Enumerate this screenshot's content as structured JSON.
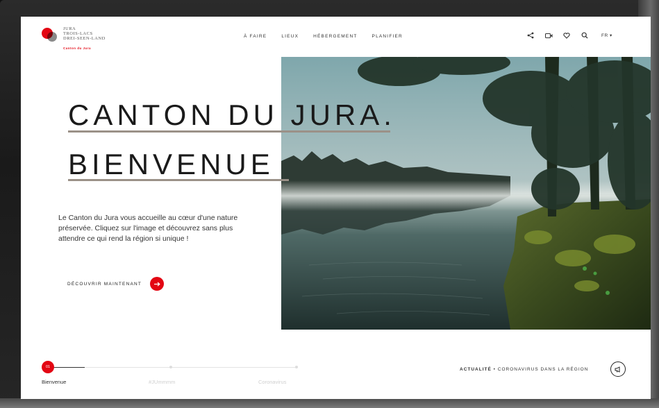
{
  "brand": {
    "lines": [
      "Jura",
      "Trois-Lacs",
      "Drei-Seen-Land"
    ],
    "sub": "Canton du Jura",
    "color_primary": "#e30613"
  },
  "nav": {
    "items": [
      "À faire",
      "Lieux",
      "Hébergement",
      "Planifier"
    ]
  },
  "tools": {
    "icons": [
      "share-icon",
      "video-icon",
      "heart-icon",
      "search-icon"
    ],
    "lang": "FR ▾"
  },
  "hero": {
    "title_line1": "CANTON DU JURA.",
    "title_line2": "BIENVENUE",
    "intro": "Le Canton du Jura vous accueille au cœur d'une nature préservée. Cliquez sur l'image et découvrez sans plus attendre ce qui rend la région si unique !",
    "cta_label": "Découvrir maintenant"
  },
  "slider": {
    "current": "01",
    "slides": [
      "Bienvenue",
      "#JUmmmm",
      "Coronavirus"
    ]
  },
  "news": {
    "label": "Actualité",
    "text": "Coronavirus dans la région"
  }
}
